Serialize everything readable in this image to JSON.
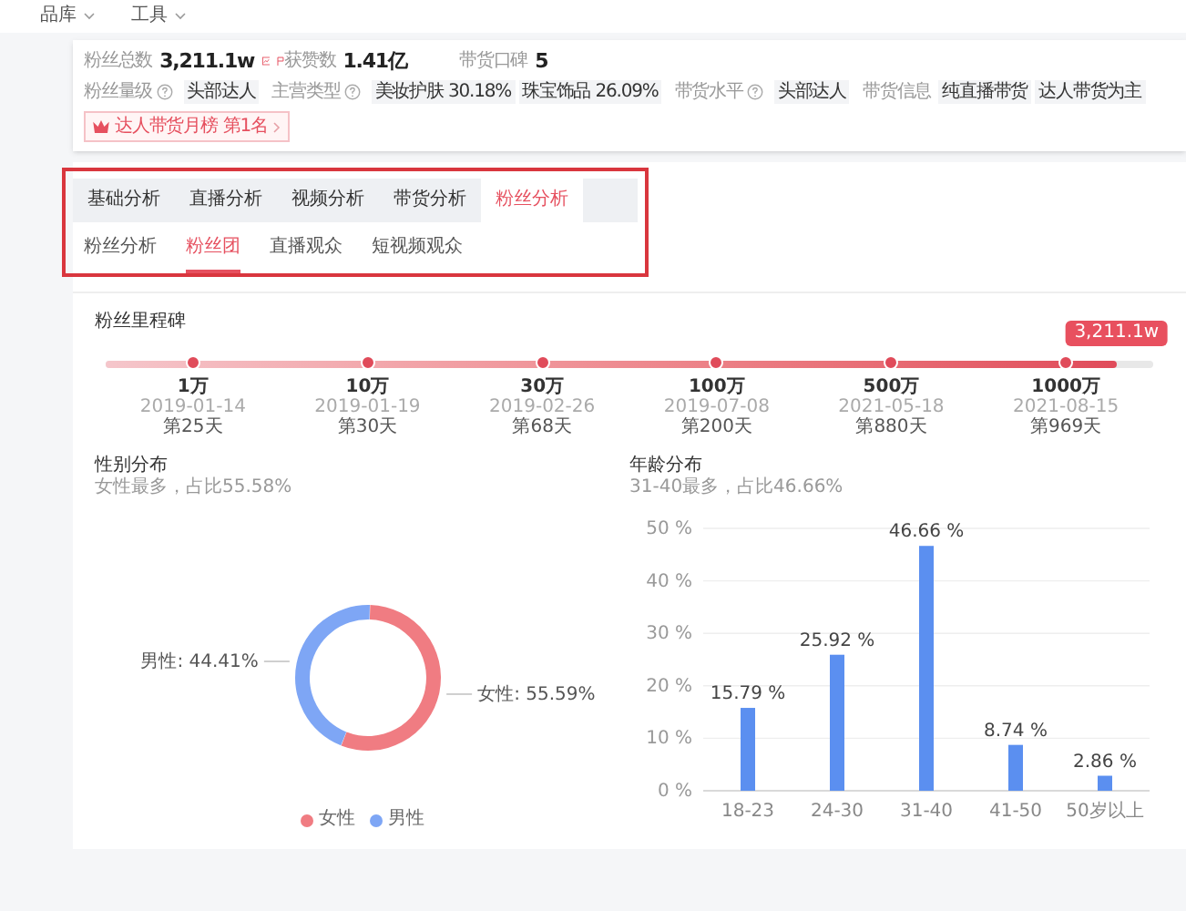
{
  "top_nav": {
    "items": [
      "品库",
      "工具"
    ]
  },
  "profile": {
    "stats": [
      {
        "label": "粉丝总数",
        "value": "3,211.1w"
      },
      {
        "label": "获赞数",
        "value": "1.41亿"
      },
      {
        "label": "带货口碑",
        "value": "5"
      }
    ],
    "attributes": [
      {
        "label": "粉丝量级",
        "help": true,
        "tags": [
          "头部达人"
        ]
      },
      {
        "label": "主营类型",
        "help": true,
        "tags": [
          "美妆护肤 30.18%",
          "珠宝饰品 26.09%"
        ]
      },
      {
        "label": "带货水平",
        "help": true,
        "tags": [
          "头部达人"
        ]
      },
      {
        "label": "带货信息",
        "help": false,
        "tags": [
          "纯直播带货",
          "达人带货为主"
        ]
      }
    ],
    "rank_badge": {
      "label": "达人带货月榜",
      "rank": "第1名"
    }
  },
  "tabs": [
    {
      "label": "基础分析",
      "selected": false
    },
    {
      "label": "直播分析",
      "selected": false
    },
    {
      "label": "视频分析",
      "selected": false
    },
    {
      "label": "带货分析",
      "selected": false
    },
    {
      "label": "粉丝分析",
      "selected": true
    }
  ],
  "sub_tabs": [
    {
      "label": "粉丝分析",
      "selected": false
    },
    {
      "label": "粉丝团",
      "selected": true
    },
    {
      "label": "直播观众",
      "selected": false
    },
    {
      "label": "短视频观众",
      "selected": false
    }
  ],
  "milestones": {
    "title": "粉丝里程碑",
    "level": 0.965,
    "current": "3,211.1w",
    "items": [
      {
        "value": "1万",
        "date": "2019-01-14",
        "day": "第25天"
      },
      {
        "value": "10万",
        "date": "2019-01-19",
        "day": "第30天"
      },
      {
        "value": "30万",
        "date": "2019-02-26",
        "day": "第68天"
      },
      {
        "value": "100万",
        "date": "2019-07-08",
        "day": "第200天"
      },
      {
        "value": "500万",
        "date": "2021-05-18",
        "day": "第880天"
      },
      {
        "value": "1000万",
        "date": "2021-08-15",
        "day": "第969天"
      }
    ]
  },
  "gender": {
    "title": "性别分布",
    "subtitle": "女性最多，占比55.58%",
    "chart_data": {
      "type": "donut",
      "categories": [
        "女性",
        "男性"
      ],
      "series": [
        {
          "values": [
            55.59,
            44.41
          ]
        }
      ],
      "colors": [
        "#f07c82",
        "#7ea6f5"
      ],
      "value_labels": [
        "女性: 55.59%",
        "男性: 44.41%"
      ]
    }
  },
  "age": {
    "title": "年龄分布",
    "subtitle": "31-40最多，占比46.66%",
    "chart_data": {
      "type": "bar",
      "categories": [
        "18-23",
        "24-30",
        "31-40",
        "41-50",
        "50岁以上"
      ],
      "series": [
        {
          "color": "#5b8ff0",
          "values": [
            15.79,
            25.92,
            46.66,
            8.74,
            2.86
          ]
        }
      ],
      "value_labels": [
        "15.79 %",
        "25.92 %",
        "46.66 %",
        "8.74 %",
        "2.86 %"
      ],
      "ylim": [
        0,
        50
      ],
      "grid": true,
      "yticks": [
        {
          "value": 0,
          "label": "0 %"
        },
        {
          "value": 10,
          "label": "10 %"
        },
        {
          "value": 20,
          "label": "20 %"
        },
        {
          "value": 30,
          "label": "30 %"
        },
        {
          "value": 40,
          "label": "40 %"
        },
        {
          "value": 50,
          "label": "50 %"
        }
      ]
    }
  }
}
